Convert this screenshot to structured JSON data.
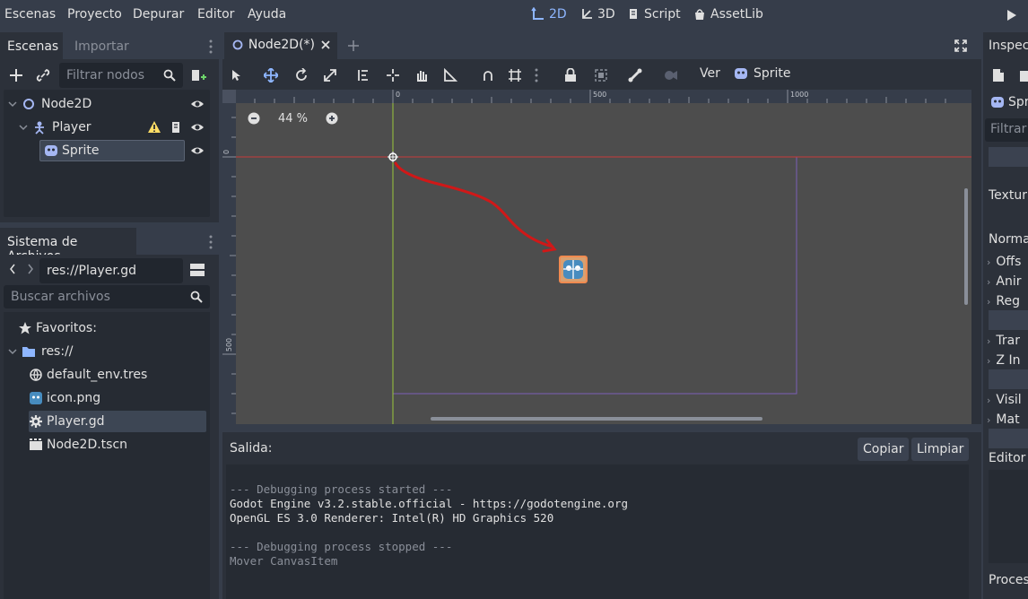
{
  "menubar": {
    "items": [
      "Escenas",
      "Proyecto",
      "Depurar",
      "Editor",
      "Ayuda"
    ],
    "workspaces": [
      "2D",
      "3D",
      "Script",
      "AssetLib"
    ]
  },
  "scene_dock": {
    "tabs": [
      "Escenas",
      "Importar"
    ],
    "filter_placeholder": "Filtrar nodos",
    "tree": [
      {
        "label": "Node2D"
      },
      {
        "label": "Player"
      },
      {
        "label": "Sprite"
      }
    ]
  },
  "filesystem_dock": {
    "title": "Sistema de Archivos",
    "path": "res://Player.gd",
    "search_placeholder": "Buscar archivos",
    "items": [
      {
        "label": "Favoritos:"
      },
      {
        "label": "res://"
      },
      {
        "label": "default_env.tres"
      },
      {
        "label": "icon.png"
      },
      {
        "label": "Player.gd"
      },
      {
        "label": "Node2D.tscn"
      }
    ]
  },
  "editor": {
    "scene_tab": "Node2D(*)",
    "toolbar_view": "Ver",
    "toolbar_sprite": "Sprite",
    "zoom": "44 %",
    "ruler_h": [
      "0",
      "500",
      "1000"
    ],
    "ruler_v": [
      "0",
      "500"
    ]
  },
  "output": {
    "title": "Salida:",
    "copy_label": "Copiar",
    "clear_label": "Limpiar",
    "lines": [
      "--- Debugging process started ---",
      "Godot Engine v3.2.stable.official - https://godotengine.org",
      "OpenGL ES 3.0 Renderer: Intel(R) HD Graphics 520",
      "",
      "--- Debugging process stopped ---",
      "Mover CanvasItem"
    ]
  },
  "inspector": {
    "title": "Inspec",
    "node": "Spr",
    "filter": "Filtrar",
    "texture_label": "Textur",
    "normal_label": "Norma",
    "rows": [
      "Offs",
      "Anir",
      "Reg",
      "Trar",
      "Z In",
      "Visil",
      "Mat"
    ],
    "editor_label": "Editor",
    "process_label": "Proces"
  },
  "colors": {
    "accent": "#8eb6ff",
    "viewport_bg": "#4d4d4d",
    "origin_x_axis": "#c83a3a",
    "origin_y_axis": "#9ac83a",
    "annotation_arrow": "#d01818"
  }
}
